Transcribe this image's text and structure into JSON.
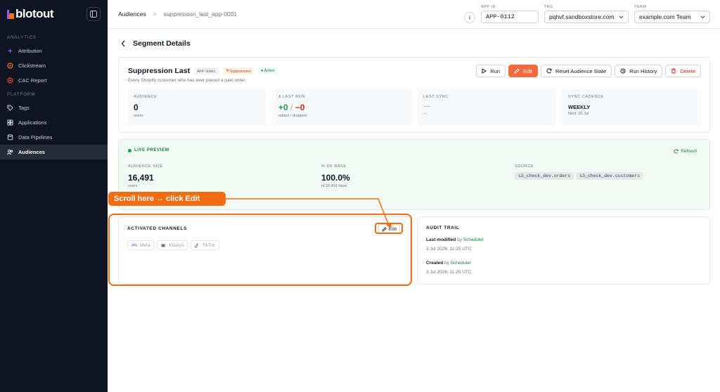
{
  "sidebar": {
    "logo_text": "blotout",
    "sections": [
      {
        "label": "ANALYTICS",
        "items": [
          {
            "label": "Attribution",
            "icon": "sparkle-icon"
          },
          {
            "label": "Clickstream",
            "icon": "clickstream-icon"
          },
          {
            "label": "CAC Report",
            "icon": "target-icon"
          }
        ]
      },
      {
        "label": "PLATFORM",
        "items": [
          {
            "label": "Tags",
            "icon": "tag-icon"
          },
          {
            "label": "Applications",
            "icon": "apps-icon"
          },
          {
            "label": "Data Pipelines",
            "icon": "database-icon"
          },
          {
            "label": "Audiences",
            "icon": "users-icon",
            "active": true
          }
        ]
      }
    ]
  },
  "header": {
    "breadcrumb_root": "Audiences",
    "breadcrumb_sep": ">",
    "breadcrumb_current": "suppression_last_app-0001",
    "app_id_label": "APP ID",
    "app_id_value": "APP-0112",
    "tag_label": "TAG",
    "tag_value": "pqhvf.sandboxstore.com",
    "team_label": "TEAM",
    "team_value": "example.com Team"
  },
  "page": {
    "title": "Segment Details"
  },
  "segment": {
    "name": "Suppression Last",
    "id_badge": "APP-0001",
    "type_badge": "Suppression",
    "status_badge": "Active",
    "description": "Every Shopify customer who has ever placed a paid order.",
    "actions": {
      "run": "Run",
      "edit": "Edit",
      "reset": "Reset Audience State",
      "history": "Run History",
      "delete": "Delete"
    },
    "stats": {
      "audience": {
        "label": "AUDIENCE",
        "value": "0",
        "sub": "users"
      },
      "last_run": {
        "label": "Δ LAST RUN",
        "added": "+0",
        "slash": " / ",
        "dropped": "−0",
        "sub": "added / dropped"
      },
      "last_sync": {
        "label": "LAST SYNC",
        "value": "—",
        "sub": "—"
      },
      "cadence": {
        "label": "SYNC CADENCE",
        "value": "WEEKLY",
        "sub": "Next: 10 Jul"
      }
    }
  },
  "preview": {
    "label": "LIVE PREVIEW",
    "refresh": "Refresh",
    "size_label": "AUDIENCE SIZE",
    "size_value": "16,491",
    "size_sub": "users",
    "pct_label": "% OF BASE",
    "pct_value": "100.0%",
    "pct_sub": "of 16,491 base",
    "source_label": "SOURCE",
    "sources": [
      "s3_check_dev.orders",
      "s3_check_dev.customers"
    ]
  },
  "channels": {
    "title": "ACTIVATED CHANNELS",
    "edit": "Edit",
    "items": [
      {
        "label": "Meta",
        "icon": "meta-icon"
      },
      {
        "label": "Klaviyo",
        "icon": "klaviyo-icon"
      },
      {
        "label": "TikTok",
        "icon": "tiktok-icon"
      }
    ]
  },
  "audit": {
    "title": "AUDIT TRAIL",
    "modified_label": "Last modified",
    "modified_by": "by",
    "modified_who": "Scheduler",
    "modified_date": "3 Jul 2026, 11:25 UTC",
    "created_label": "Created",
    "created_by": "by",
    "created_who": "Scheduler",
    "created_date": "3 Jul 2026, 11:25 UTC"
  },
  "annotation": {
    "callout_text": "Scroll here → click Edit",
    "color": "#f26c12"
  }
}
